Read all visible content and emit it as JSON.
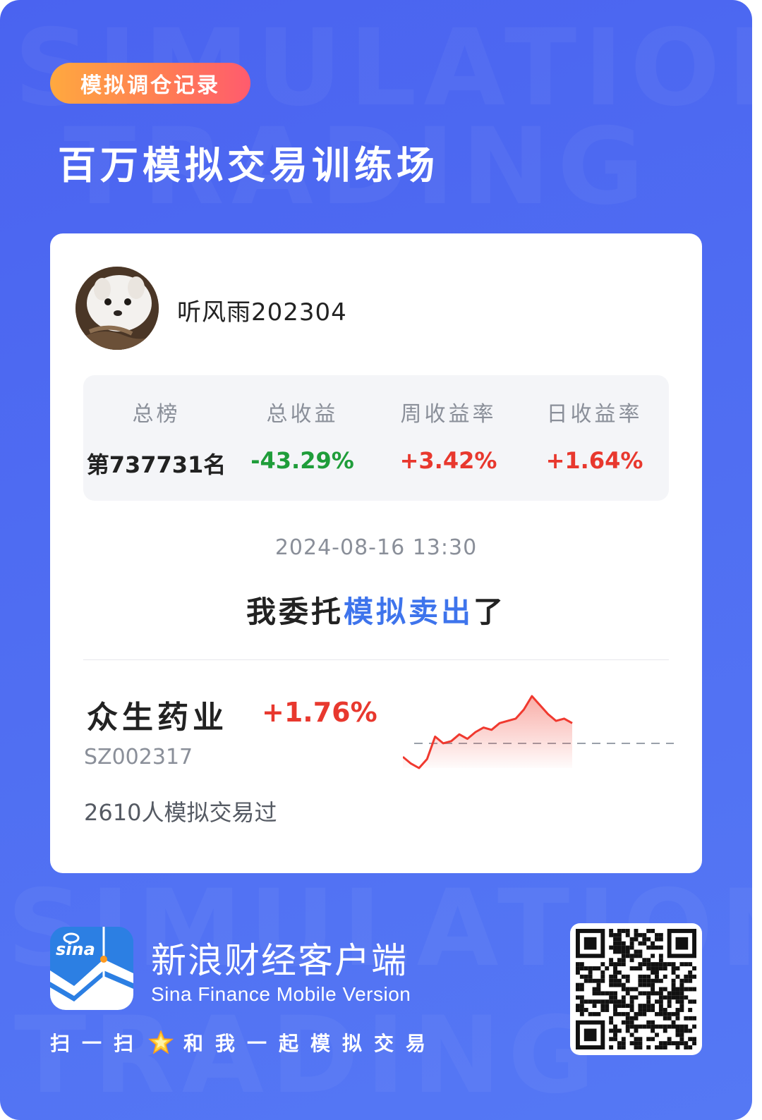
{
  "header": {
    "tag": "模拟调仓记录",
    "title": "百万模拟交易训练场",
    "bg_words": [
      "SIMULATION",
      "TRADING",
      "SIMULATION",
      "TRADING"
    ]
  },
  "user": {
    "name": "听风雨202304"
  },
  "stats": [
    {
      "label": "总榜",
      "value": "第737731名",
      "color": "#222222"
    },
    {
      "label": "总收益",
      "value": "-43.29%",
      "color": "#1f9d3a"
    },
    {
      "label": "周收益率",
      "value": "+3.42%",
      "color": "#e8382e"
    },
    {
      "label": "日收益率",
      "value": "+1.64%",
      "color": "#e8382e"
    }
  ],
  "trade": {
    "datetime": "2024-08-16 13:30",
    "action_prefix": "我委托",
    "action_highlight": "模拟卖出",
    "action_suffix": "了"
  },
  "stock": {
    "name": "众生药业",
    "change": "+1.76%",
    "change_color": "#e8382e",
    "code": "SZ002317",
    "traders": "2610人模拟交易过",
    "sparkline": [
      -0.6,
      -0.9,
      -1.1,
      -0.7,
      0.3,
      0.0,
      0.1,
      0.4,
      0.2,
      0.5,
      0.7,
      0.6,
      0.9,
      1.0,
      1.1,
      1.5,
      2.1,
      1.7,
      1.3,
      1.0,
      1.1,
      0.9
    ],
    "baseline": 0
  },
  "footer": {
    "app_name": "新浪财经客户端",
    "app_sub": "Sina Finance Mobile Version",
    "logo_text": "sina",
    "scan_prefix": "扫一扫",
    "scan_suffix": "和我一起模拟交易"
  },
  "icons": {
    "avatar": "dog-avatar-icon",
    "star": "star-icon",
    "qr": "qr-code-icon",
    "logo": "sina-logo-icon"
  },
  "colors": {
    "accent": "#3e74ec",
    "up": "#e8382e",
    "down": "#1f9d3a",
    "background": "#4f6df2"
  }
}
